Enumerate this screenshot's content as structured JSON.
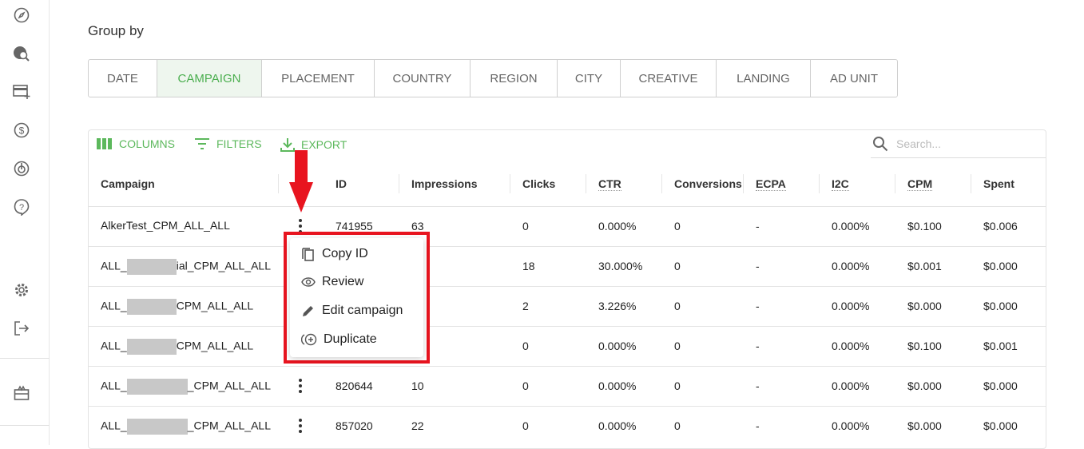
{
  "group_by": {
    "label": "Group by",
    "tabs": [
      "DATE",
      "CAMPAIGN",
      "PLACEMENT",
      "COUNTRY",
      "REGION",
      "CITY",
      "CREATIVE",
      "LANDING",
      "AD UNIT"
    ],
    "active": "CAMPAIGN"
  },
  "toolbar": {
    "columns": "COLUMNS",
    "filters": "FILTERS",
    "export": "EXPORT",
    "search_placeholder": "Search..."
  },
  "accent_color": "#5cb85c",
  "table": {
    "headers": [
      "Campaign",
      "ID",
      "Impressions",
      "Clicks",
      "CTR",
      "Conversions",
      "ECPA",
      "I2C",
      "CPM",
      "Spent"
    ],
    "rows": [
      {
        "pre": "AlkerTest_CPM_ALL_ALL",
        "post": "",
        "id": "741955",
        "imp": "63",
        "clicks": "0",
        "ctr": "0.000%",
        "conv": "0",
        "ecpa": "-",
        "i2c": "0.000%",
        "cpm": "$0.100",
        "spent": "$0.006"
      },
      {
        "pre": "ALL_",
        "post": "ial_CPM_ALL_ALL",
        "id": "",
        "imp": "",
        "clicks": "18",
        "ctr": "30.000%",
        "conv": "0",
        "ecpa": "-",
        "i2c": "0.000%",
        "cpm": "$0.001",
        "spent": "$0.000"
      },
      {
        "pre": "ALL_",
        "post": "CPM_ALL_ALL",
        "id": "",
        "imp": "",
        "clicks": "2",
        "ctr": "3.226%",
        "conv": "0",
        "ecpa": "-",
        "i2c": "0.000%",
        "cpm": "$0.000",
        "spent": "$0.000"
      },
      {
        "pre": "ALL_",
        "post": "CPM_ALL_ALL",
        "id": "",
        "imp": "",
        "clicks": "0",
        "ctr": "0.000%",
        "conv": "0",
        "ecpa": "-",
        "i2c": "0.000%",
        "cpm": "$0.100",
        "spent": "$0.001"
      },
      {
        "pre": "ALL_",
        "post": "_CPM_ALL_ALL",
        "id": "820644",
        "imp": "10",
        "clicks": "0",
        "ctr": "0.000%",
        "conv": "0",
        "ecpa": "-",
        "i2c": "0.000%",
        "cpm": "$0.000",
        "spent": "$0.000"
      },
      {
        "pre": "ALL_",
        "post": "_CPM_ALL_ALL",
        "id": "857020",
        "imp": "22",
        "clicks": "0",
        "ctr": "0.000%",
        "conv": "0",
        "ecpa": "-",
        "i2c": "0.000%",
        "cpm": "$0.000",
        "spent": "$0.000"
      }
    ]
  },
  "context_menu": {
    "items": [
      "Copy ID",
      "Review",
      "Edit campaign",
      "Duplicate"
    ]
  }
}
